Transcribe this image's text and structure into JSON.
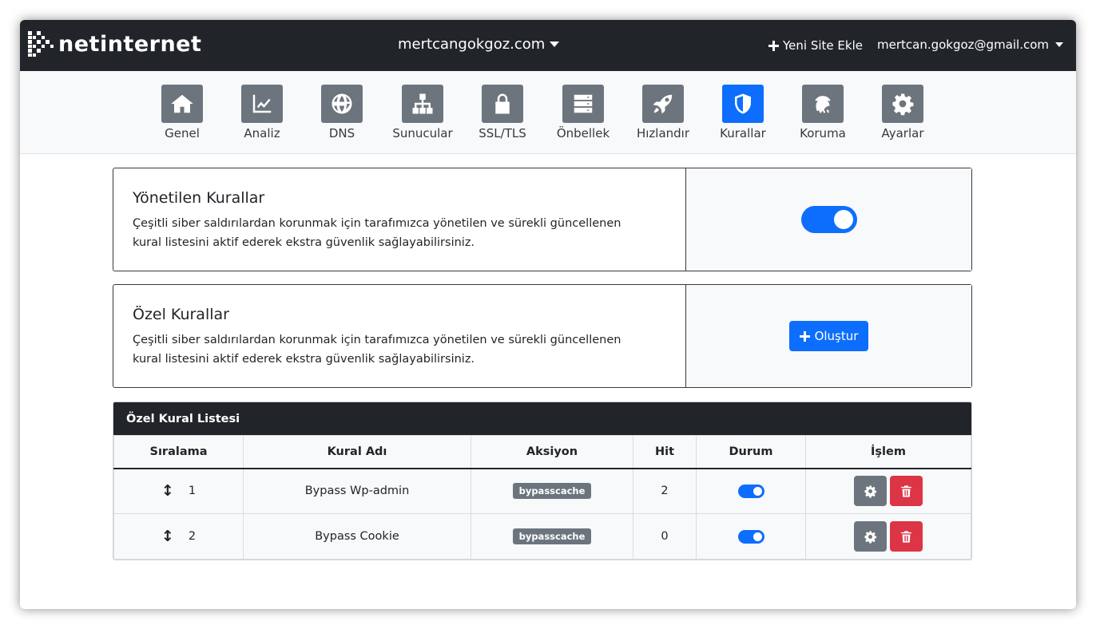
{
  "header": {
    "logo_text": "netinternet",
    "domain": "mertcangokgoz.com",
    "add_site_label": "Yeni Site Ekle",
    "user_email": "mertcan.gokgoz@gmail.com"
  },
  "nav": {
    "items": [
      {
        "label": "Genel",
        "icon": "home-icon"
      },
      {
        "label": "Analiz",
        "icon": "chart-line-icon"
      },
      {
        "label": "DNS",
        "icon": "globe-icon"
      },
      {
        "label": "Sunucular",
        "icon": "network-icon"
      },
      {
        "label": "SSL/TLS",
        "icon": "lock-icon"
      },
      {
        "label": "Önbellek",
        "icon": "server-icon"
      },
      {
        "label": "Hızlandır",
        "icon": "rocket-icon"
      },
      {
        "label": "Kurallar",
        "icon": "shield-icon"
      },
      {
        "label": "Koruma",
        "icon": "fingerprint-icon"
      },
      {
        "label": "Ayarlar",
        "icon": "gear-icon"
      }
    ],
    "active": "Kurallar"
  },
  "managed_rules": {
    "title": "Yönetilen Kurallar",
    "description": "Çeşitli siber saldırılardan korunmak için tarafımızca yönetilen ve sürekli güncellenen kural listesini aktif ederek ekstra güvenlik sağlayabilirsiniz.",
    "enabled": true
  },
  "custom_rules": {
    "title": "Özel Kurallar",
    "description": "Çeşitli siber saldırılardan korunmak için tarafımızca yönetilen ve sürekli güncellenen kural listesini aktif ederek ekstra güvenlik sağlayabilirsiniz.",
    "create_label": "Oluştur"
  },
  "rule_table": {
    "title": "Özel Kural Listesi",
    "columns": {
      "order": "Sıralama",
      "name": "Kural Adı",
      "action": "Aksiyon",
      "hit": "Hit",
      "status": "Durum",
      "ops": "İşlem"
    },
    "rows": [
      {
        "order": "1",
        "name": "Bypass Wp-admin",
        "action": "bypasscache",
        "hit": "2",
        "enabled": true
      },
      {
        "order": "2",
        "name": "Bypass Cookie",
        "action": "bypasscache",
        "hit": "0",
        "enabled": true
      }
    ]
  },
  "colors": {
    "topbar": "#212529",
    "primary": "#0d6efd",
    "secondary": "#6c757d",
    "danger": "#dc3545"
  }
}
